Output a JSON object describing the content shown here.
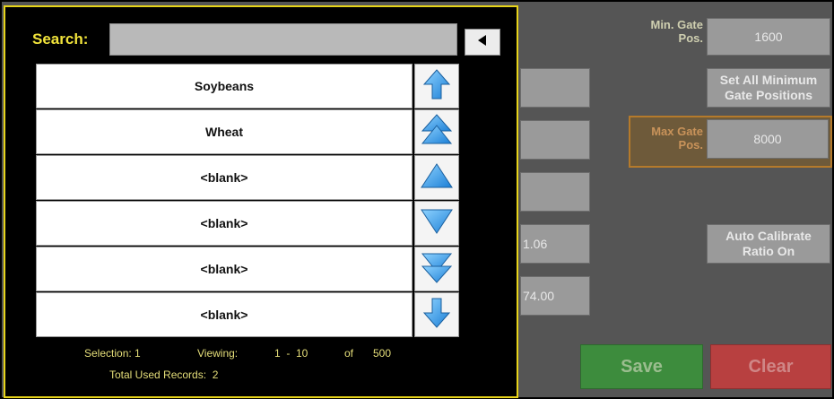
{
  "search": {
    "label": "Search:",
    "value": "",
    "placeholder": ""
  },
  "list": {
    "items": [
      "Soybeans",
      "Wheat",
      "<blank>",
      "<blank>",
      "<blank>",
      "<blank>"
    ]
  },
  "footer": {
    "selection": "Selection: 1",
    "viewing_label": "Viewing:",
    "viewing_range": "1  -  10",
    "of_label": "of",
    "total": "500",
    "total_used": "Total Used Records:  2"
  },
  "background": {
    "min_gate_label": "Min. Gate\nPos.",
    "min_gate_value": "1600",
    "set_all_button": "Set All Minimum\nGate Positions",
    "max_gate_label": "Max Gate\nPos.",
    "max_gate_value": "8000",
    "auto_calibrate_button": "Auto Calibrate\nRatio On",
    "value_1": "1.06",
    "value_2": "74.00",
    "save_label": "Save",
    "clear_label": "Clear"
  }
}
